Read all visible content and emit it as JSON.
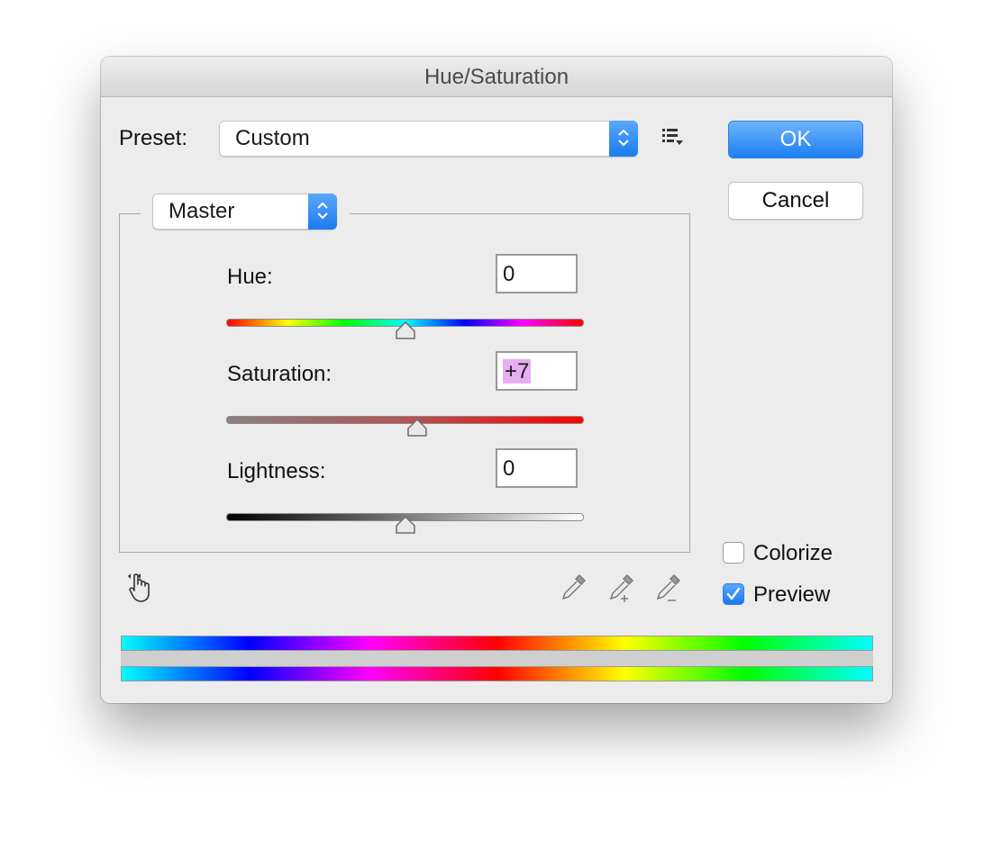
{
  "window": {
    "title": "Hue/Saturation"
  },
  "preset": {
    "label": "Preset:",
    "value": "Custom",
    "menu_icon": "list-menu-icon"
  },
  "buttons": {
    "ok": "OK",
    "cancel": "Cancel"
  },
  "channel": {
    "value": "Master"
  },
  "adjustments": {
    "hue": {
      "label": "Hue:",
      "value": "0",
      "slider_fraction": 0.5
    },
    "saturation": {
      "label": "Saturation:",
      "value": "+7",
      "slider_fraction": 0.535
    },
    "lightness": {
      "label": "Lightness:",
      "value": "0",
      "slider_fraction": 0.5
    }
  },
  "options": {
    "colorize": {
      "label": "Colorize",
      "checked": false
    },
    "preview": {
      "label": "Preview",
      "checked": true
    }
  },
  "tools": [
    "targeted-adjustment-hand-icon",
    "eyedropper-icon",
    "eyedropper-plus-icon",
    "eyedropper-minus-icon"
  ],
  "colors": {
    "accent": "#1a7bef",
    "selection_highlight": "#e6b0f0"
  }
}
